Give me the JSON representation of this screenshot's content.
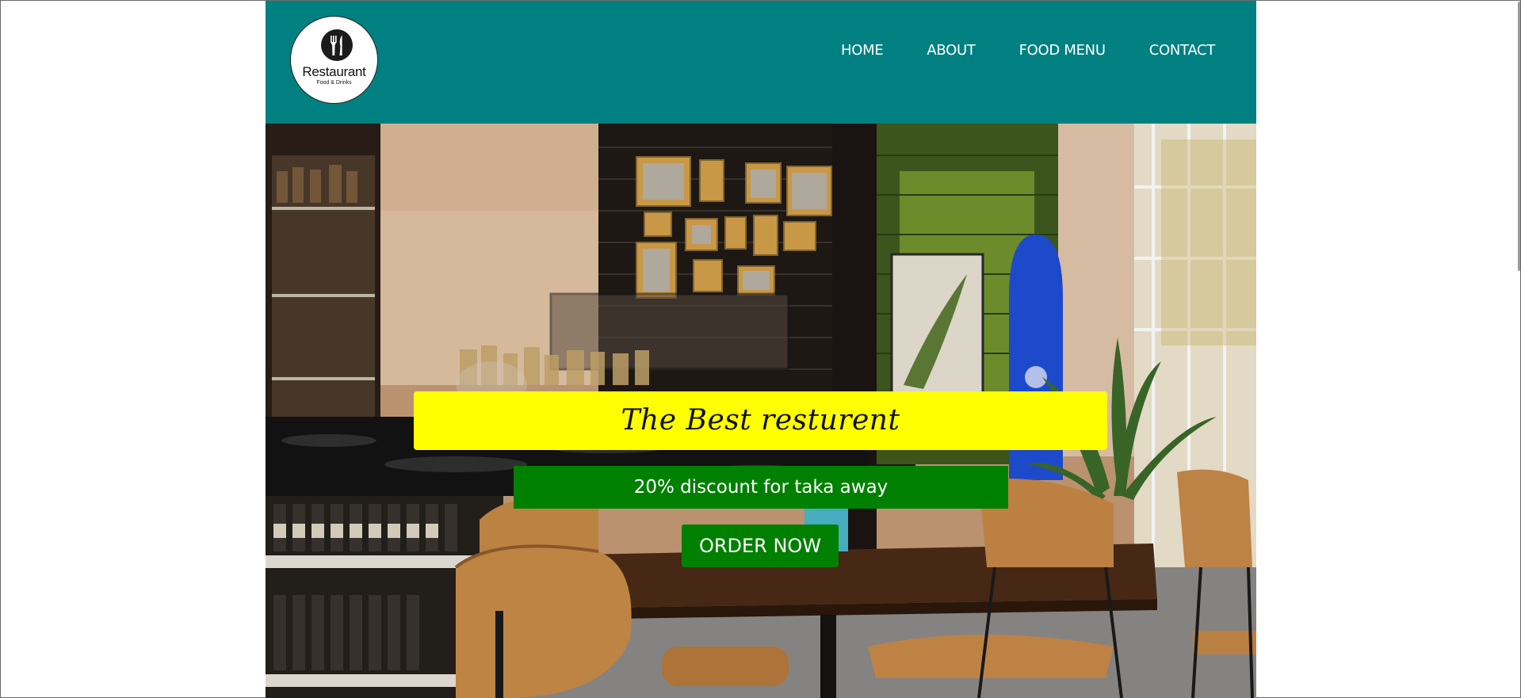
{
  "logo": {
    "name": "Restaurant",
    "tagline": "Food & Drinks"
  },
  "nav": {
    "items": [
      "HOME",
      "ABOUT",
      "FOOD MENU",
      "CONTACT"
    ]
  },
  "hero": {
    "headline": "The Best resturent",
    "discount": "20% discount for taka away",
    "cta_label": "ORDER NOW"
  },
  "colors": {
    "navbar": "#008080",
    "headline_bg": "#ffff00",
    "accent_green": "#008000"
  }
}
